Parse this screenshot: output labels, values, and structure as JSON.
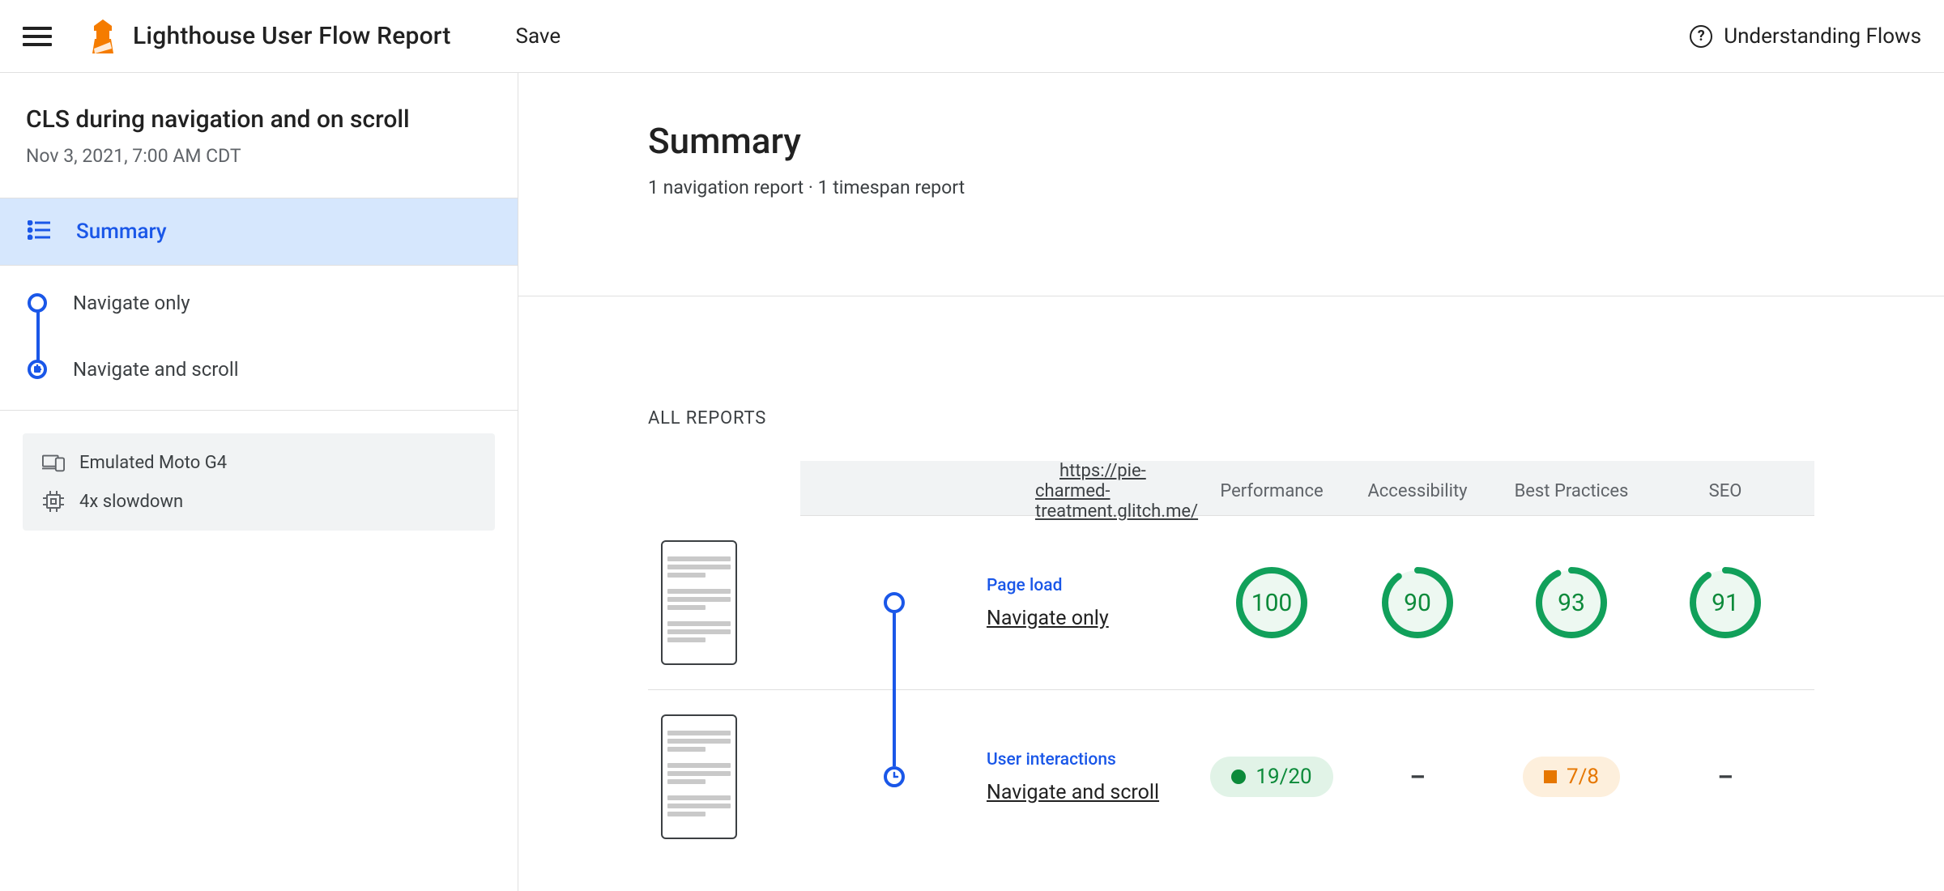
{
  "header": {
    "title": "Lighthouse User Flow Report",
    "save_label": "Save",
    "help_label": "Understanding Flows"
  },
  "sidebar": {
    "flow_title": "CLS during navigation and on scroll",
    "flow_date": "Nov 3, 2021, 7:00 AM CDT",
    "summary_label": "Summary",
    "steps": [
      {
        "label": "Navigate only",
        "mode": "navigation"
      },
      {
        "label": "Navigate and scroll",
        "mode": "timespan"
      }
    ],
    "env": {
      "device": "Emulated Moto G4",
      "cpu": "4x slowdown"
    }
  },
  "main": {
    "title": "Summary",
    "subtitle": "1 navigation report · 1 timespan report",
    "section_label": "ALL REPORTS",
    "table": {
      "url": "https://pie-charmed-treatment.glitch.me/",
      "columns": [
        "Performance",
        "Accessibility",
        "Best Practices",
        "SEO"
      ],
      "rows": [
        {
          "type_label": "Page load",
          "name": "Navigate only",
          "mode": "navigation",
          "cells": [
            {
              "kind": "gauge",
              "value": 100,
              "pct": 100
            },
            {
              "kind": "gauge",
              "value": 90,
              "pct": 90
            },
            {
              "kind": "gauge",
              "value": 93,
              "pct": 93
            },
            {
              "kind": "gauge",
              "value": 91,
              "pct": 91
            }
          ]
        },
        {
          "type_label": "User interactions",
          "name": "Navigate and scroll",
          "mode": "timespan",
          "cells": [
            {
              "kind": "pill",
              "color": "green",
              "text": "19/20"
            },
            {
              "kind": "dash"
            },
            {
              "kind": "pill",
              "color": "orange",
              "text": "7/8"
            },
            {
              "kind": "dash"
            }
          ]
        }
      ]
    }
  }
}
